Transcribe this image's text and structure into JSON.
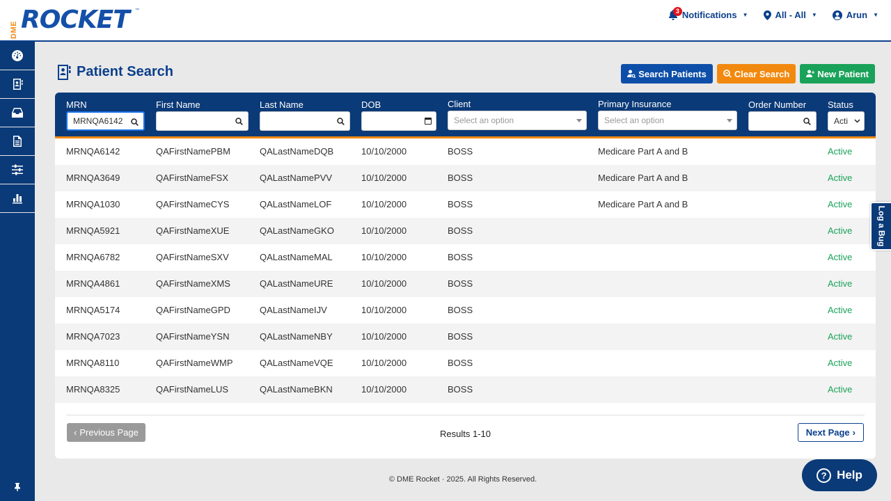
{
  "brand": {
    "dme": "DME",
    "name": "ROCKET",
    "tm": "™"
  },
  "topnav": {
    "notifications_label": "Notifications",
    "notifications_count": "3",
    "location_label": "All - All",
    "user_label": "Arun"
  },
  "sidebar": {
    "items": [
      "dashboard-icon",
      "patient-book-icon",
      "inbox-icon",
      "document-icon",
      "sliders-icon",
      "bar-chart-icon"
    ],
    "pin": "pin-icon"
  },
  "page": {
    "title": "Patient Search",
    "search_button": "Search Patients",
    "clear_button": "Clear Search",
    "new_button": "New Patient"
  },
  "filters": {
    "mrn_label": "MRN",
    "mrn_value": "MRNQA6142",
    "first_name_label": "First Name",
    "last_name_label": "Last Name",
    "dob_label": "DOB",
    "client_label": "Client",
    "client_placeholder": "Select an option",
    "insurance_label": "Primary Insurance",
    "insurance_placeholder": "Select an option",
    "order_label": "Order Number",
    "status_label": "Status",
    "status_value": "Acti"
  },
  "rows": [
    {
      "mrn": "MRNQA6142",
      "first": "QAFirstNamePBM",
      "last": "QALastNameDQB",
      "dob": "10/10/2000",
      "client": "BOSS",
      "insurance": "Medicare Part A and B",
      "status": "Active"
    },
    {
      "mrn": "MRNQA3649",
      "first": "QAFirstNameFSX",
      "last": "QALastNamePVV",
      "dob": "10/10/2000",
      "client": "BOSS",
      "insurance": "Medicare Part A and B",
      "status": "Active"
    },
    {
      "mrn": "MRNQA1030",
      "first": "QAFirstNameCYS",
      "last": "QALastNameLOF",
      "dob": "10/10/2000",
      "client": "BOSS",
      "insurance": "Medicare Part A and B",
      "status": "Active"
    },
    {
      "mrn": "MRNQA5921",
      "first": "QAFirstNameXUE",
      "last": "QALastNameGKO",
      "dob": "10/10/2000",
      "client": "BOSS",
      "insurance": "",
      "status": "Active"
    },
    {
      "mrn": "MRNQA6782",
      "first": "QAFirstNameSXV",
      "last": "QALastNameMAL",
      "dob": "10/10/2000",
      "client": "BOSS",
      "insurance": "",
      "status": "Active"
    },
    {
      "mrn": "MRNQA4861",
      "first": "QAFirstNameXMS",
      "last": "QALastNameURE",
      "dob": "10/10/2000",
      "client": "BOSS",
      "insurance": "",
      "status": "Active"
    },
    {
      "mrn": "MRNQA5174",
      "first": "QAFirstNameGPD",
      "last": "QALastNameIJV",
      "dob": "10/10/2000",
      "client": "BOSS",
      "insurance": "",
      "status": "Active"
    },
    {
      "mrn": "MRNQA7023",
      "first": "QAFirstNameYSN",
      "last": "QALastNameNBY",
      "dob": "10/10/2000",
      "client": "BOSS",
      "insurance": "",
      "status": "Active"
    },
    {
      "mrn": "MRNQA8110",
      "first": "QAFirstNameWMP",
      "last": "QALastNameVQE",
      "dob": "10/10/2000",
      "client": "BOSS",
      "insurance": "",
      "status": "Active"
    },
    {
      "mrn": "MRNQA8325",
      "first": "QAFirstNameLUS",
      "last": "QALastNameBKN",
      "dob": "10/10/2000",
      "client": "BOSS",
      "insurance": "",
      "status": "Active"
    }
  ],
  "pagination": {
    "prev": "Previous Page",
    "results": "Results 1-10",
    "next": "Next Page"
  },
  "footer": {
    "copyright": "© DME Rocket · 2025. All Rights Reserved."
  },
  "log_bug": "Log a Bug",
  "help": {
    "label": "Help",
    "icon": "?"
  },
  "colors": {
    "navy": "#0b3a78",
    "blue": "#0d4fa8",
    "orange": "#f2890f",
    "green": "#1aa25a"
  }
}
